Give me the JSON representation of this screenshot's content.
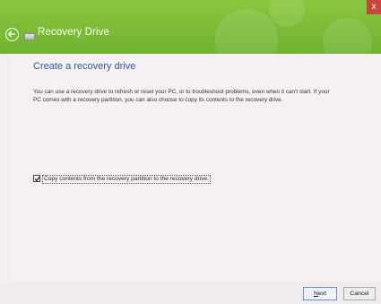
{
  "window": {
    "title": "Recovery Drive",
    "close_label": "x"
  },
  "icons": {
    "back": "back-arrow-icon",
    "drive": "drive-icon",
    "check": "checkmark-icon"
  },
  "colors": {
    "titlebar": "#6fb231",
    "heading": "#2f57a6",
    "close": "#c9463d"
  },
  "main": {
    "heading": "Create a recovery drive",
    "description": "You can use a recovery drive to refresh or reset your PC, or to troubleshoot problems, even when it can't start. If your PC comes with a recovery partition, you can also choose to copy its contents to the recovery drive.",
    "checkbox": {
      "label": "Copy contents from the recovery partition to the recovery drive.",
      "checked": true
    }
  },
  "footer": {
    "next_accel": "N",
    "next_rest": "ext",
    "cancel_label": "Cancel"
  }
}
